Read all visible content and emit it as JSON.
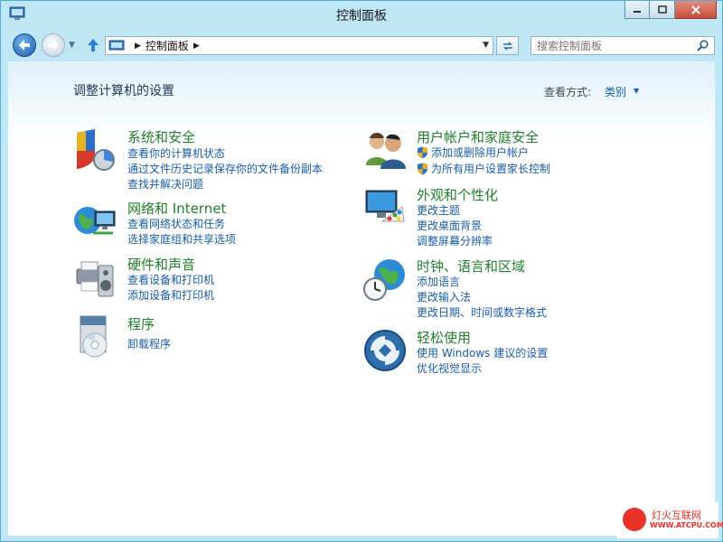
{
  "window": {
    "title": "控制面板"
  },
  "address_bar": {
    "path": "控制面板"
  },
  "search": {
    "placeholder": "搜索控制面板"
  },
  "main": {
    "heading": "调整计算机的设置",
    "view_by_label": "查看方式:",
    "view_by_value": "类别"
  },
  "categories": [
    {
      "title": "系统和安全",
      "links": [
        "查看你的计算机状态",
        "通过文件历史记录保存你的文件备份副本",
        "查找并解决问题"
      ]
    },
    {
      "title": "网络和 Internet",
      "links": [
        "查看网络状态和任务",
        "选择家庭组和共享选项"
      ]
    },
    {
      "title": "硬件和声音",
      "links": [
        "查看设备和打印机",
        "添加设备和打印机"
      ]
    },
    {
      "title": "程序",
      "links": [
        "卸载程序"
      ]
    },
    {
      "title": "用户帐户和家庭安全",
      "links": [
        "添加或删除用户帐户",
        "为所有用户设置家长控制"
      ]
    },
    {
      "title": "外观和个性化",
      "links": [
        "更改主题",
        "更改桌面背景",
        "调整屏幕分辨率"
      ]
    },
    {
      "title": "时钟、语言和区域",
      "links": [
        "添加语言",
        "更改输入法",
        "更改日期、时间或数字格式"
      ]
    },
    {
      "title": "轻松使用",
      "links": [
        "使用 Windows 建议的设置",
        "优化视觉显示"
      ]
    }
  ],
  "watermark": {
    "logo_label": "灯火互联网",
    "logo_url_text": "WWW.ATCPU.COM"
  },
  "colors": {
    "link": "#1a5ea5",
    "category_title": "#237d2e",
    "window_frame": "#bfe6f5",
    "close_button": "#c74e3a"
  }
}
